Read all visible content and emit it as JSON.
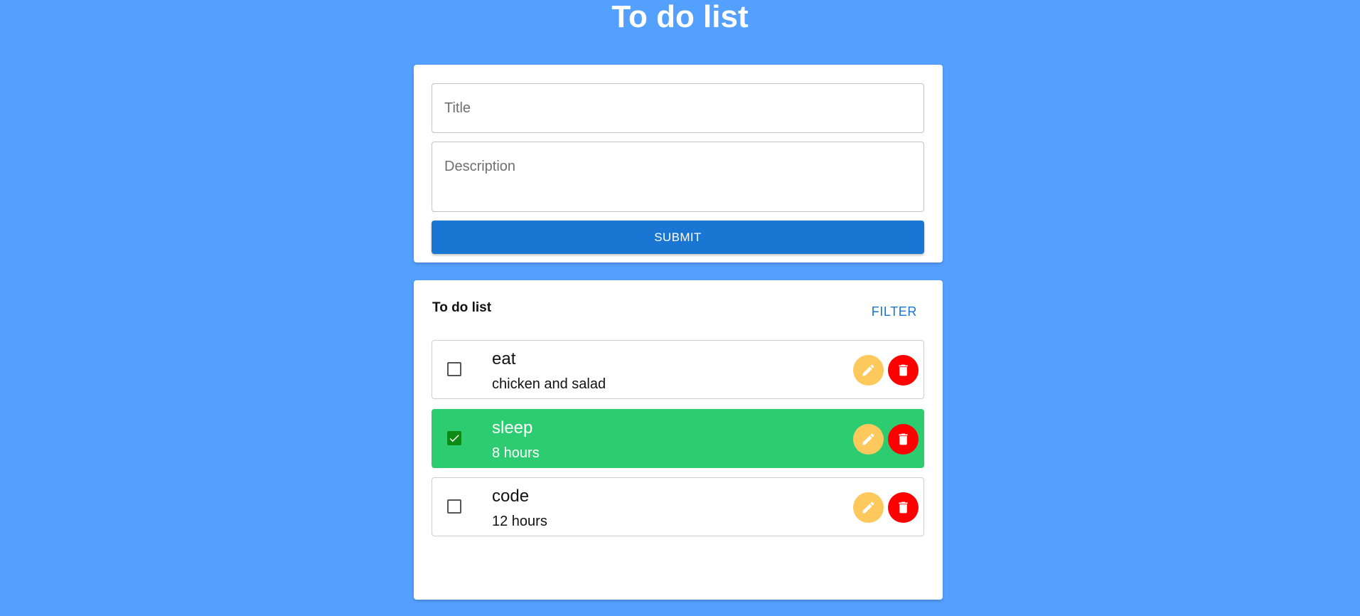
{
  "header": {
    "title": "To do list"
  },
  "form": {
    "title_placeholder": "Title",
    "description_placeholder": "Description",
    "submit_label": "SUBMIT"
  },
  "list": {
    "heading": "To do list",
    "filter_label": "FILTER",
    "items": [
      {
        "title": "eat",
        "description": "chicken and salad",
        "done": false
      },
      {
        "title": "sleep",
        "description": "8 hours",
        "done": true
      },
      {
        "title": "code",
        "description": "12 hours",
        "done": false
      }
    ]
  },
  "icons": {
    "checkbox": "checkbox-icon",
    "edit": "pencil-icon",
    "delete": "trash-icon"
  },
  "colors": {
    "background": "#54a0ff",
    "primary": "#1976d2",
    "done_row": "#2ecc71",
    "checked_box": "#0d8a12",
    "edit_button": "#fdc85c",
    "delete_button": "#ff0000"
  }
}
